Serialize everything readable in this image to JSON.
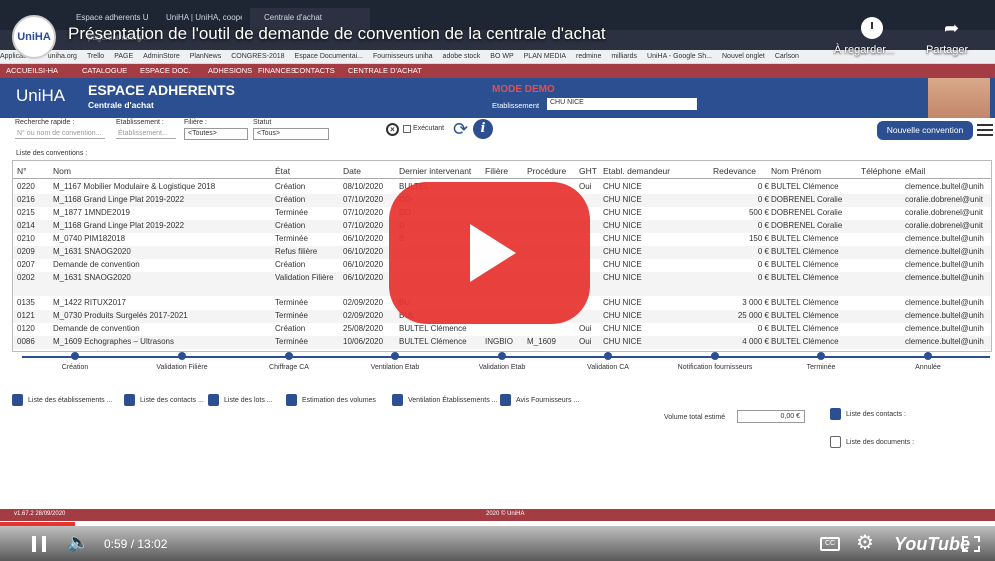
{
  "video": {
    "title": "Présentation de l'outil de demande de convention de la centrale d'achat",
    "channel_avatar": "UniHA",
    "watch_later": "À regarder...",
    "share": "Partager",
    "time": "0:59 / 13:02",
    "progress_fraction": 0.075,
    "cc": "CC",
    "logo": "YouTube"
  },
  "browser": {
    "tabs": [
      "Espace adherents U",
      "UniHA | UniHA, coopérative d'ac",
      "Centrale d'achat"
    ],
    "url": "page.uniha.org/...",
    "bookmarks": [
      "Applications",
      "uniha.org",
      "Trello",
      "PAGE",
      "AdminStore",
      "PlanNews",
      "CONGRES-2018",
      "Espace Documentai...",
      "Fournisseurs uniha",
      "adobe stock",
      "BO WP",
      "PLAN MEDIA",
      "redmine",
      "milliards",
      "UniHA - Google Sh...",
      "Nouvel onglet",
      "Carlson"
    ]
  },
  "menu": [
    "ACCUEIL",
    "SI-HA",
    "CATALOGUE",
    "ESPACE DOC.",
    "ADHESIONS",
    "FINANCES",
    "CONTACTS",
    "CENTRALE D'ACHAT"
  ],
  "header": {
    "logo": "UniHA",
    "title": "ESPACE ADHERENTS",
    "subtitle": "Centrale d'achat",
    "mode": "MODE DEMO",
    "etab_label": "Etablissement",
    "etab_value": "CHU NICE"
  },
  "filters": {
    "recherche_label": "Recherche rapide :",
    "recherche_placeholder": "N° ou nom de convention...",
    "etab_label": "Etablissement :",
    "etab_placeholder": "Établissement...",
    "filiere_label": "Filière :",
    "filiere_value": "<Toutes>",
    "statut_label": "Statut",
    "statut_value": "<Tous>",
    "executant": "Exécutant",
    "new_button": "Nouvelle convention"
  },
  "list_label": "Liste des conventions :",
  "columns": [
    "N°",
    "Nom",
    "État",
    "Date",
    "Dernier intervenant",
    "Filière",
    "Procédure",
    "GHT",
    "Etabl. demandeur",
    "Redevance",
    "Nom Prénom",
    "Téléphone",
    "eMail"
  ],
  "rows": [
    [
      "0220",
      "M_1167 Mobilier Modulaire & Logistique 2018",
      "Création",
      "08/10/2020",
      "BULTEL",
      "",
      "",
      "Oui",
      "CHU NICE",
      "0 €",
      "BULTEL Clémence",
      "",
      "clemence.bultel@unih"
    ],
    [
      "0216",
      "M_1168 Grand Linge Plat 2019-2022",
      "Création",
      "07/10/2020",
      "DO",
      "",
      "",
      "",
      "CHU NICE",
      "0 €",
      "DOBRENEL Coralie",
      "",
      "coralie.dobrenel@unit"
    ],
    [
      "0215",
      "M_1877 1MNDE2019",
      "Terminée",
      "07/10/2020",
      "DO",
      "",
      "",
      "",
      "CHU NICE",
      "500 €",
      "DOBRENEL Coralie",
      "",
      "coralie.dobrenel@unit"
    ],
    [
      "0214",
      "M_1168 Grand Linge Plat 2019-2022",
      "Création",
      "07/10/2020",
      "D",
      "",
      "",
      "",
      "CHU NICE",
      "0 €",
      "DOBRENEL Coralie",
      "",
      "coralie.dobrenel@unit"
    ],
    [
      "0210",
      "M_0740 PIM182018",
      "Terminée",
      "06/10/2020",
      "B",
      "",
      "",
      "",
      "CHU NICE",
      "150 €",
      "BULTEL Clémence",
      "",
      "clemence.bultel@unih"
    ],
    [
      "0209",
      "M_1631 SNAOG2020",
      "Refus filière",
      "06/10/2020",
      "",
      "",
      "",
      "",
      "CHU NICE",
      "0 €",
      "BULTEL Clémence",
      "",
      "clemence.bultel@unih"
    ],
    [
      "0207",
      "Demande de convention",
      "Création",
      "06/10/2020",
      "",
      "",
      "",
      "",
      "CHU NICE",
      "0 €",
      "BULTEL Clémence",
      "",
      "clemence.bultel@unih"
    ],
    [
      "0202",
      "M_1631 SNAOG2020",
      "Validation Filière",
      "06/10/2020",
      "",
      "",
      "",
      "",
      "CHU NICE",
      "0 €",
      "BULTEL Clémence",
      "",
      "clemence.bultel@unih"
    ],
    [
      "0135",
      "M_1422 RITUX2017",
      "Terminée",
      "02/09/2020",
      "BU",
      "",
      "",
      "",
      "CHU NICE",
      "3 000 €",
      "BULTEL Clémence",
      "",
      "clemence.bultel@unih"
    ],
    [
      "0121",
      "M_0730 Produits Surgelés 2017-2021",
      "Terminée",
      "02/09/2020",
      "BUL",
      "",
      "",
      "",
      "CHU NICE",
      "25 000 €",
      "BULTEL Clémence",
      "",
      "clemence.bultel@unih"
    ],
    [
      "0120",
      "Demande de convention",
      "Création",
      "25/08/2020",
      "BULTEL Clémence",
      "",
      "",
      "Oui",
      "CHU NICE",
      "0 €",
      "BULTEL Clémence",
      "",
      "clemence.bultel@unih"
    ],
    [
      "0086",
      "M_1609 Echographes – Ultrasons",
      "Terminée",
      "10/06/2020",
      "BULTEL Clémence",
      "INGBIO",
      "M_1609",
      "Oui",
      "CHU NICE",
      "4 000 €",
      "BULTEL Clémence",
      "",
      "clemence.bultel@unih"
    ]
  ],
  "workflow": [
    "Création",
    "Validation Filière",
    "Chiffrage CA",
    "Ventilation Etab",
    "Validation Etab",
    "Validation CA",
    "Notification fournisseurs",
    "Terminée",
    "Annulée"
  ],
  "actions": [
    "Liste des établissements ...",
    "Liste des contacts ...",
    "Liste des lots ...",
    "Estimation des volumes",
    "Ventilation Établissements ...",
    "Avis Fournisseurs ..."
  ],
  "volume": {
    "label": "Volume total estimé",
    "value": "0,00 €"
  },
  "right_links": [
    "Liste des contacts :",
    "Liste des documents :"
  ],
  "footer": {
    "version": "v1.67.2 28/09/2020",
    "copyright": "2020 © UniHA"
  }
}
